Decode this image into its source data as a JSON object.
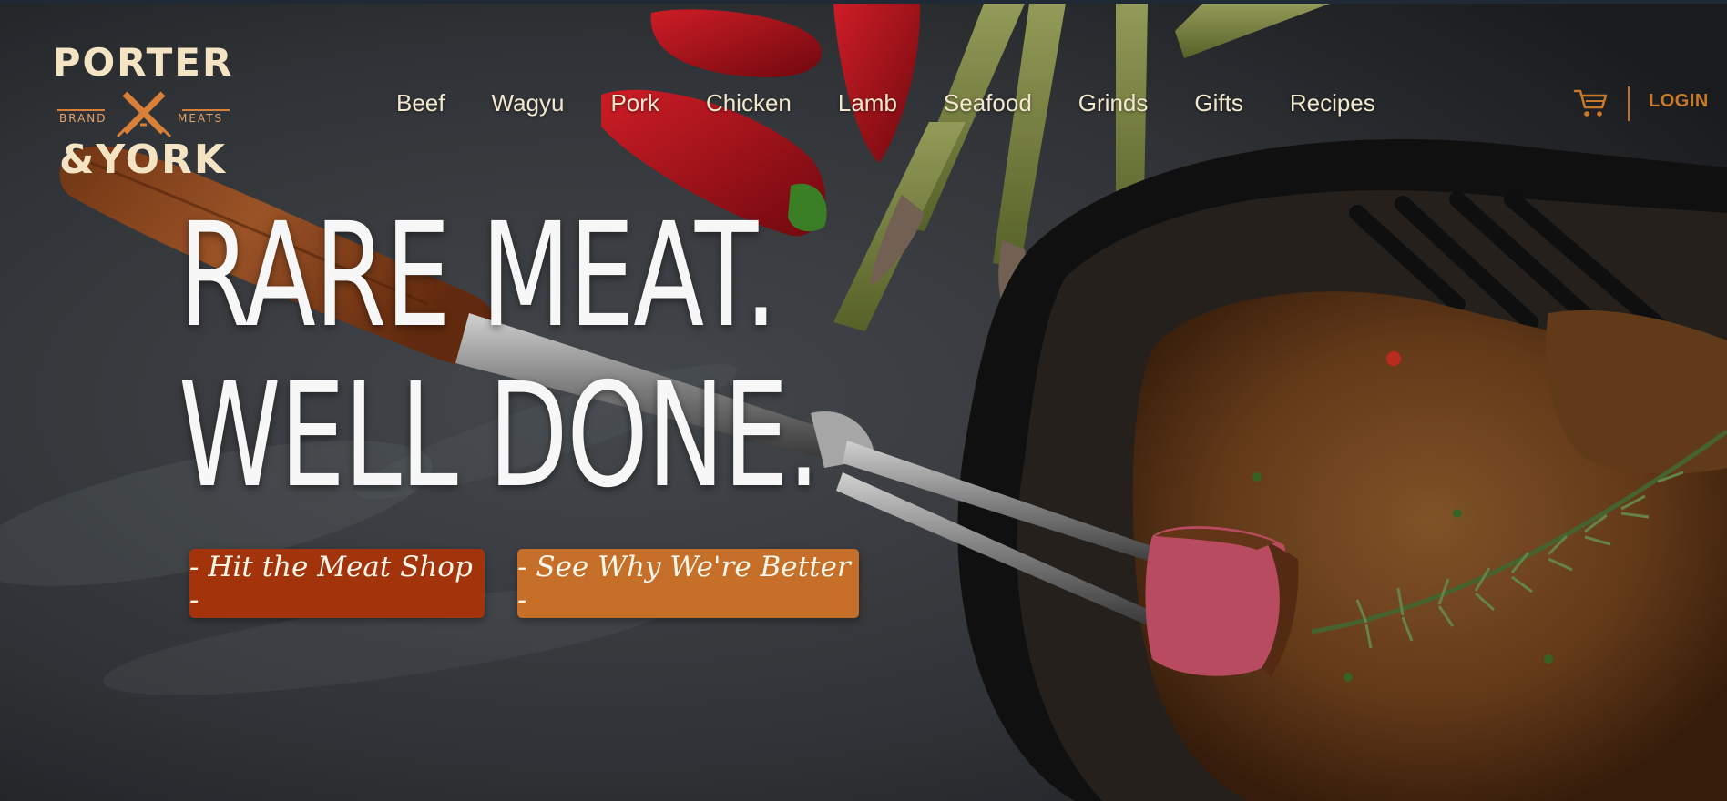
{
  "brand": {
    "name_top": "PORTER",
    "name_bottom": "&YORK",
    "tag_left": "BRAND",
    "tag_right": "MEATS"
  },
  "nav": {
    "items": [
      "Beef",
      "Wagyu",
      "Pork",
      "Chicken",
      "Lamb",
      "Seafood",
      "Grinds",
      "Gifts",
      "Recipes"
    ],
    "cart_icon": "cart-icon",
    "login_label": "LOGIN"
  },
  "hero": {
    "line1": "RARE MEAT.",
    "line2": "WELL DONE.",
    "primary_cta": "- Hit the Meat Shop -",
    "secondary_cta": "- See Why We're Better -"
  },
  "colors": {
    "nav_text": "#f3e7cf",
    "accent_orange": "#c56f28",
    "accent_rust": "#a3330a",
    "logo_cream": "#f4e4c4"
  }
}
